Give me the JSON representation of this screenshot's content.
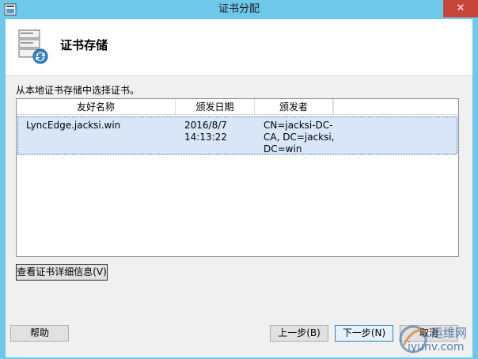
{
  "window": {
    "title": "证书分配",
    "close_glyph": "✕"
  },
  "header": {
    "title": "证书存储",
    "icon": "certificate-store-icon"
  },
  "instruction": "从本地证书存储中选择证书。",
  "list": {
    "columns": [
      "友好名称",
      "颁发日期",
      "颁发者"
    ],
    "rows": [
      {
        "name": "LyncEdge.jacksi.win",
        "date": "2016/8/7\n14:13:22",
        "issuer": "CN=jacksi-DC-\nCA, DC=jacksi,\nDC=win"
      }
    ]
  },
  "buttons": {
    "view_details": "查看证书详细信息(V)",
    "help": "帮助",
    "back": "上一步(B)",
    "next": "下一步(N)",
    "cancel": "取消"
  },
  "watermark": {
    "top": "运维网",
    "bottom": "iyunv.com"
  },
  "colors": {
    "titlebar": "#6ec8ea",
    "close": "#c7463b",
    "selection": "#d8e6f8"
  }
}
